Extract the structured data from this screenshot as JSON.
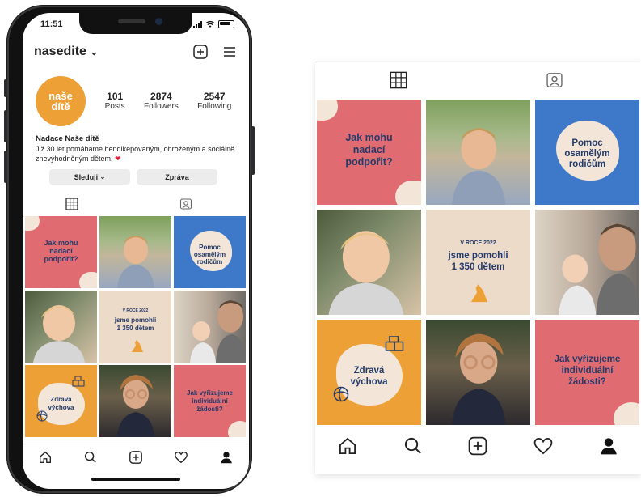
{
  "status": {
    "time": "11:51"
  },
  "profile": {
    "username": "nasedite",
    "avatar_line1": "naše",
    "avatar_line2": "dítě",
    "stats": [
      {
        "value": "101",
        "label": "Posts"
      },
      {
        "value": "2874",
        "label": "Followers"
      },
      {
        "value": "2547",
        "label": "Following"
      }
    ],
    "bio_name": "Nadace Naše dítě",
    "bio_text": "Již 30 let pomáháme hendikepovaným, ohroženým a sociálně znevýhodněným dětem.",
    "follow_button": "Sleduji",
    "message_button": "Zpráva"
  },
  "posts": {
    "p1": "Jak mohu nadací podpořit?",
    "p3": "Pomoc osamělým rodičům",
    "p5_small": "V ROCE 2022",
    "p5_main": "jsme pomohli 1 350 dětem",
    "p7": "Zdravá výchova",
    "p9": "Jak vyřizujeme individuální žádosti?"
  },
  "icons": {
    "add": "add-post-icon",
    "menu": "hamburger-menu-icon",
    "grid": "grid-icon",
    "tagged": "tagged-icon",
    "nav": [
      "home-icon",
      "search-icon",
      "add-icon",
      "heart-icon",
      "profile-icon"
    ]
  },
  "colors": {
    "pink": "#e06c72",
    "blue": "#3e79c9",
    "beige": "#eddbc9",
    "orange": "#eda035",
    "heading_text": "#233a6b"
  }
}
